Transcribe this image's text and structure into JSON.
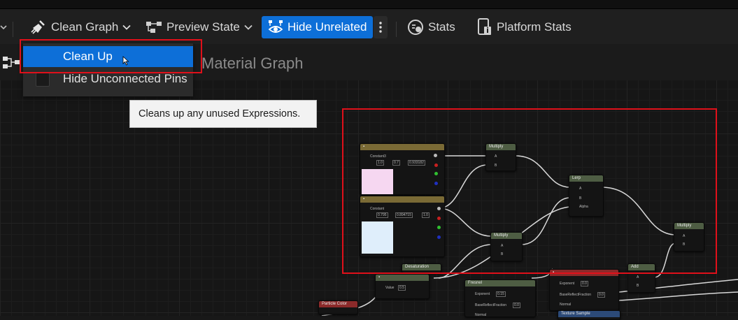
{
  "toolbar": {
    "clean_graph_label": "Clean Graph",
    "preview_state_label": "Preview State",
    "hide_unrelated_label": "Hide Unrelated",
    "stats_label": "Stats",
    "platform_stats_label": "Platform Stats"
  },
  "graph": {
    "title": "Material Graph"
  },
  "dropdown": {
    "items": [
      {
        "label": "Clean Up"
      },
      {
        "label": "Hide Unconnected Pins"
      }
    ]
  },
  "tooltip": {
    "text": "Cleans up any unused Expressions."
  },
  "nodes": {
    "multiply_top": "Multiply",
    "lerp": "Lerp",
    "multiply_mid": "Multiply",
    "multiply_right": "Multiply",
    "desaturation": "Desaturation",
    "fresnel": "Fresnel",
    "add": "Add",
    "particle_color": "Particle Color",
    "texture_sample": "Texture Sample",
    "pin_a": "A",
    "pin_b": "B",
    "pin_alpha": "Alpha",
    "constant3_title": "Constant3",
    "constant3_values": [
      "1.0",
      "0.7",
      "0.933182"
    ],
    "constant3b_title": "Constant",
    "constant3b_values": [
      "0.795",
      "0.894715",
      "1.0"
    ],
    "value_label": "Value",
    "value_num": "0.5",
    "exponent_label": "Exponent",
    "exponent_val": "0.15",
    "base_reflect_label": "BaseReflectFraction",
    "base_reflect_val": "0.0",
    "normal_label": "Normal",
    "exp_label2": "Exponent",
    "exp_val2": "0.0",
    "base_reflect_label2": "BaseReflectFraction",
    "base_reflect_val2": "0.0",
    "normal_label2": "Normal"
  },
  "colors": {
    "accent": "#0d6fd8",
    "highlight_border": "#e0101a",
    "node_header_green": "#4e5d43",
    "node_header_gold": "#7a6a35",
    "particle_header": "#8b2a2a",
    "texture_header": "#2c4a78"
  }
}
